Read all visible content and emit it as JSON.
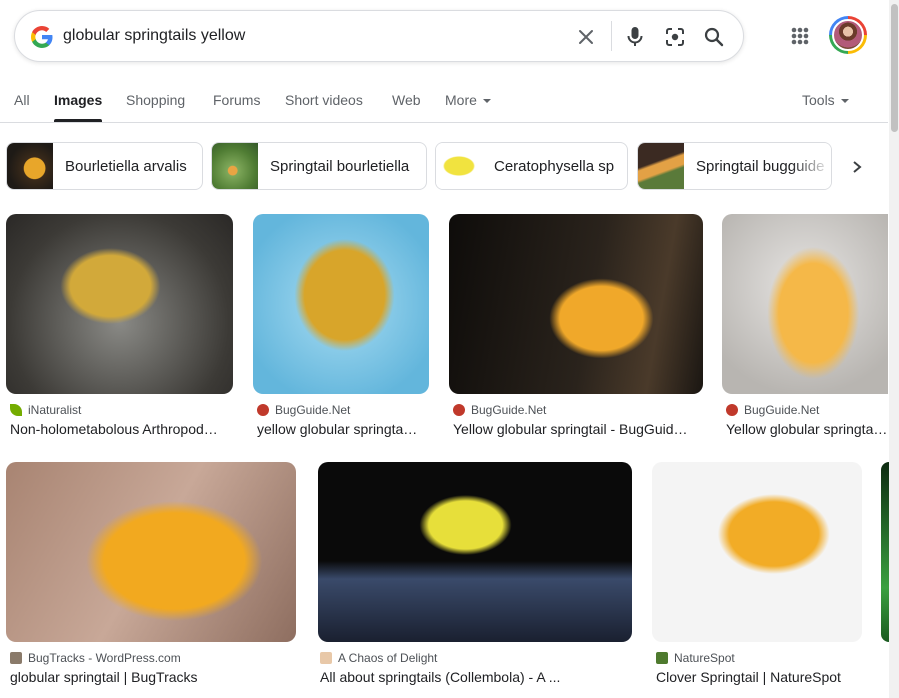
{
  "search": {
    "query": "globular springtails yellow"
  },
  "tabs": [
    {
      "label": "All"
    },
    {
      "label": "Images"
    },
    {
      "label": "Shopping"
    },
    {
      "label": "Forums"
    },
    {
      "label": "Short videos"
    },
    {
      "label": "Web"
    },
    {
      "label": "More"
    }
  ],
  "tools_label": "Tools",
  "chips": [
    {
      "label": "Bourletiella arvalis"
    },
    {
      "label": "Springtail bourletiella"
    },
    {
      "label": "Ceratophysella sp"
    },
    {
      "label": "Springtail bugguide"
    }
  ],
  "results_row1": [
    {
      "source": "iNaturalist",
      "caption": "Non-holometabolous Arthropod…"
    },
    {
      "source": "BugGuide.Net",
      "caption": "yellow globular springta…"
    },
    {
      "source": "BugGuide.Net",
      "caption": "Yellow globular springtail - BugGuid…"
    },
    {
      "source": "BugGuide.Net",
      "caption": "Yellow globular springta…"
    }
  ],
  "results_row2": [
    {
      "source": "BugTracks - WordPress.com",
      "caption": "globular springtail | BugTracks"
    },
    {
      "source": "A Chaos of Delight",
      "caption": "All about springtails (Collembola) - A ..."
    },
    {
      "source": "NatureSpot",
      "caption": "Clover Springtail | NatureSpot"
    }
  ],
  "colors": {
    "accent": "#202124",
    "muted": "#5f6368",
    "border": "#dadce0",
    "springtail": "#f0b62a"
  }
}
